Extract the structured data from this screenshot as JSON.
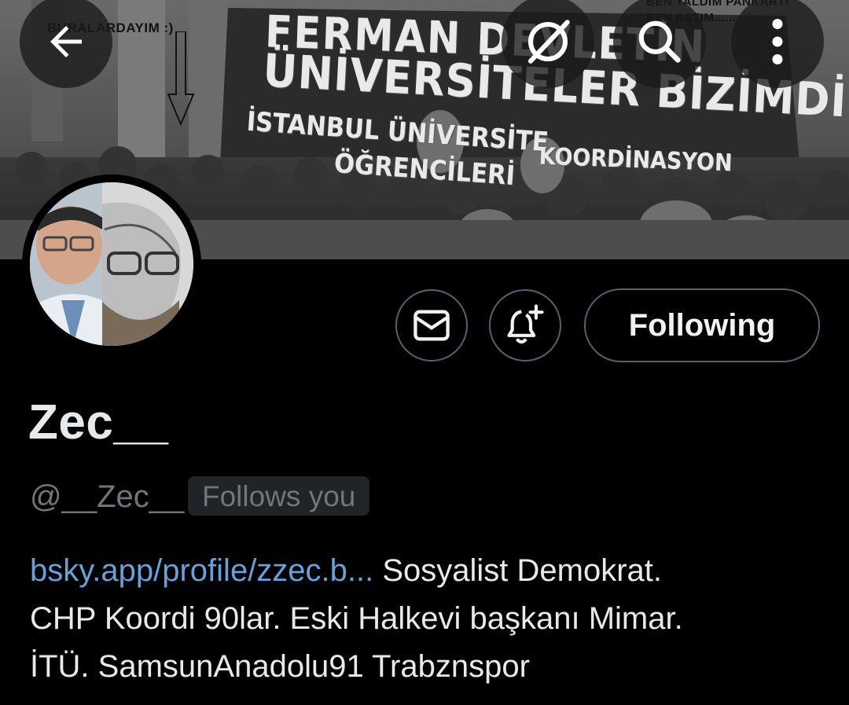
{
  "banner": {
    "handwritten_left": "BURALARDAYIM :)",
    "handwritten_right_1": "BEN YALDIM PANKARTI",
    "handwritten_right_2": "BEN ASTIM......",
    "sign_line1": "FERMAN DEVLETİN",
    "sign_line2": "ÜNİVERSİTELER BİZİMDİR",
    "sign_line3": "İSTANBUL ÜNİVERSİTE",
    "sign_line4": "ÖĞRENCİLERİ",
    "sign_line5": "KOORDİNASYON"
  },
  "toolbar": {
    "back_icon": "arrow-left-icon",
    "grok_icon": "grok-icon",
    "search_icon": "search-icon",
    "more_icon": "more-vertical-icon"
  },
  "actions": {
    "message_icon": "envelope-icon",
    "notify_icon": "bell-plus-icon",
    "following_label": "Following"
  },
  "profile": {
    "display_name": "Zec__",
    "handle": "@__Zec__",
    "follows_you": "Follows you",
    "bio_link": "bsky.app/profile/zzec.b...",
    "bio_line1_rest": " Sosyalist Demokrat.",
    "bio_line2": "CHP  Koordi 90lar. Eski Halkevi başkanı Mimar.",
    "bio_line3": "İTÜ. SamsunAnadolu91 Trabznspor"
  },
  "colors": {
    "background": "#000000",
    "text_primary": "#e7e9ea",
    "text_secondary": "#71767b",
    "link": "#6b9fd8",
    "border": "#536471"
  }
}
